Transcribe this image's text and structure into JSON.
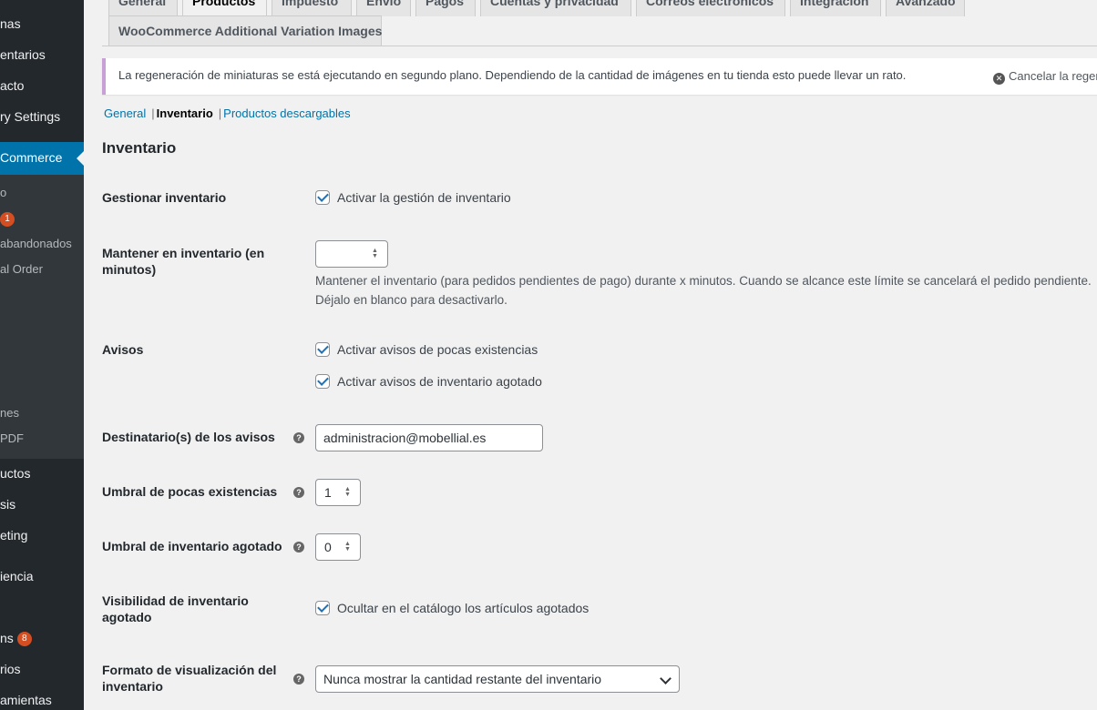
{
  "sidebar": {
    "items": [
      {
        "label": "nas"
      },
      {
        "label": "entarios"
      },
      {
        "label": "acto"
      },
      {
        "label": "ry Settings"
      },
      {
        "label": "Commerce"
      },
      {
        "label": "o"
      },
      {
        "label": "",
        "badge": "1"
      },
      {
        "label": "abandonados"
      },
      {
        "label": "al Order"
      },
      {
        "label": "nes"
      },
      {
        "label": "PDF"
      },
      {
        "label": "uctos"
      },
      {
        "label": "sis"
      },
      {
        "label": "eting"
      },
      {
        "label": "iencia"
      },
      {
        "label": "ns",
        "badge": "8"
      },
      {
        "label": "rios"
      },
      {
        "label": "amientas"
      }
    ]
  },
  "tabs": [
    {
      "label": "General"
    },
    {
      "label": "Productos"
    },
    {
      "label": "Impuesto"
    },
    {
      "label": "Envío"
    },
    {
      "label": "Pagos"
    },
    {
      "label": "Cuentas y privacidad"
    },
    {
      "label": "Correos electrónicos"
    },
    {
      "label": "Integración"
    },
    {
      "label": "Avanzado"
    },
    {
      "label": "WooCommerce Additional Variation Images"
    }
  ],
  "notice": {
    "text": "La regeneración de miniaturas se está ejecutando en segundo plano. Dependiendo de la cantidad de imágenes en tu tienda esto puede llevar un rato.",
    "cancel": "Cancelar la regeneración"
  },
  "subnav": {
    "general": "General",
    "inventario": "Inventario",
    "descargables": "Productos descargables"
  },
  "section_title": "Inventario",
  "fields": {
    "gestionar": {
      "label": "Gestionar inventario",
      "checkbox": "Activar la gestión de inventario"
    },
    "mantener": {
      "label": "Mantener en inventario (en minutos)",
      "value": "",
      "desc": "Mantener el inventario (para pedidos pendientes de pago) durante x minutos. Cuando se alcance este límite se cancelará el pedido pendiente. Déjalo en blanco para desactivarlo."
    },
    "avisos": {
      "label": "Avisos",
      "checkbox1": "Activar avisos de pocas existencias",
      "checkbox2": "Activar avisos de inventario agotado"
    },
    "destinatario": {
      "label": "Destinatario(s) de los avisos",
      "value": "administracion@mobellial.es"
    },
    "umbral_pocas": {
      "label": "Umbral de pocas existencias",
      "value": "1"
    },
    "umbral_agotado": {
      "label": "Umbral de inventario agotado",
      "value": "0"
    },
    "visibilidad": {
      "label": "Visibilidad de inventario agotado",
      "checkbox": "Ocultar en el catálogo los artículos agotados"
    },
    "formato": {
      "label": "Formato de visualización del inventario",
      "value": "Nunca mostrar la cantidad restante del inventario"
    }
  },
  "colors": {
    "accent": "#0073aa",
    "sidebar": "#23282d",
    "notice_border": "#c9a0d6"
  }
}
